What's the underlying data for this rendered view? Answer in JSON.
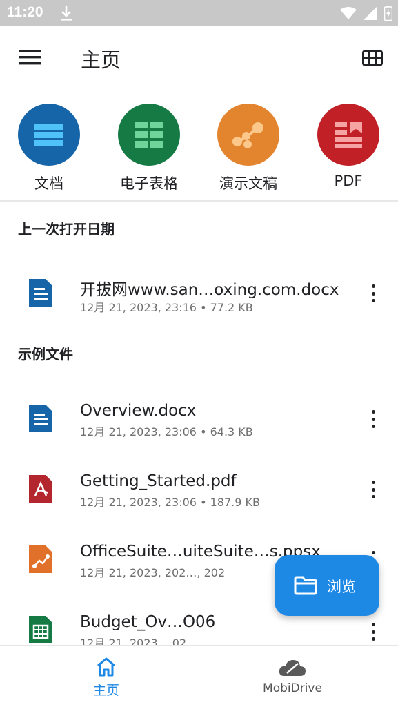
{
  "status": {
    "time": "11:20"
  },
  "app_bar": {
    "title": "主页"
  },
  "categories": [
    {
      "label": "文档",
      "color": "#1565a8"
    },
    {
      "label": "电子表格",
      "color": "#167a45"
    },
    {
      "label": "演示文稿",
      "color": "#e3852f"
    },
    {
      "label": "PDF",
      "color": "#c12027"
    }
  ],
  "sections": {
    "recent": {
      "title": "上一次打开日期"
    },
    "samples": {
      "title": "示例文件"
    }
  },
  "recent_files": [
    {
      "name": "开拔网www.san…oxing.com.docx",
      "meta": "12月 21, 2023, 23:16 • 77.2 KB",
      "icon": "docx-file-icon"
    }
  ],
  "sample_files": [
    {
      "name": "Overview.docx",
      "meta": "12月 21, 2023, 23:06 • 64.3 KB",
      "icon": "docx-file-icon"
    },
    {
      "name": "Getting_Started.pdf",
      "meta": "12月 21, 2023, 23:06 • 187.9 KB",
      "icon": "pdf-file-icon"
    },
    {
      "name": "OfficeSuite…uiteSuite…s.ppsx",
      "meta": "12月 21, 2023, 202…, 202",
      "icon": "ppsx-file-icon"
    },
    {
      "name": "Budget_Ov…O06",
      "meta": "12月 21, 2023 …02",
      "icon": "xlsx-file-icon"
    }
  ],
  "fab": {
    "label": "浏览"
  },
  "bottom_nav": [
    {
      "label": "主页",
      "icon": "home-icon",
      "active": true,
      "color": "#1e88e5"
    },
    {
      "label": "MobiDrive",
      "icon": "cloud-icon",
      "active": false,
      "color": "#555555"
    }
  ]
}
